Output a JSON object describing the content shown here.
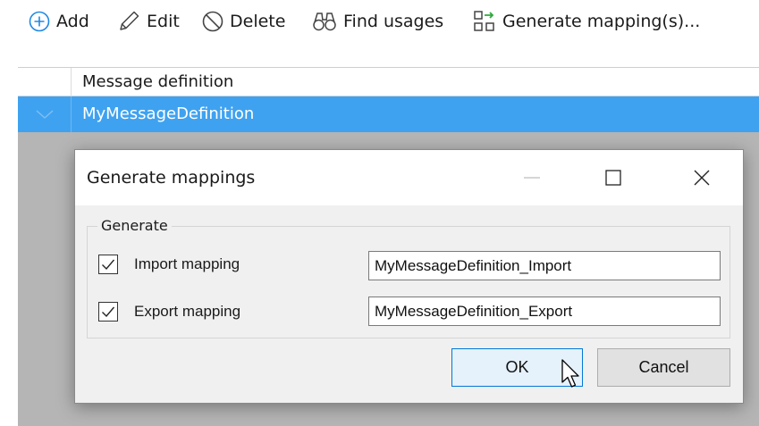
{
  "toolbar": {
    "add_label": "Add",
    "edit_label": "Edit",
    "delete_label": "Delete",
    "find_usages_label": "Find usages",
    "generate_label": "Generate mapping(s)..."
  },
  "grid": {
    "column_header": "Message definition",
    "rows": [
      {
        "name": "MyMessageDefinition",
        "selected": true
      }
    ]
  },
  "dialog": {
    "title": "Generate mappings",
    "group_label": "Generate",
    "import": {
      "label": "Import mapping",
      "checked": true,
      "value": "MyMessageDefinition_Import"
    },
    "export": {
      "label": "Export mapping",
      "checked": true,
      "value": "MyMessageDefinition_Export"
    },
    "ok_label": "OK",
    "cancel_label": "Cancel"
  },
  "colors": {
    "accent": "#0078d7",
    "selection": "#3fa2f0",
    "add_icon": "#1e88e5",
    "generate_icon_accent": "#2eaa3c"
  },
  "icons": {
    "add": "plus-circle-icon",
    "edit": "pencil-icon",
    "delete": "no-entry-icon",
    "find_usages": "binoculars-icon",
    "generate": "generate-mapping-icon",
    "minimize": "minimize-icon",
    "maximize": "maximize-icon",
    "close": "close-icon"
  }
}
